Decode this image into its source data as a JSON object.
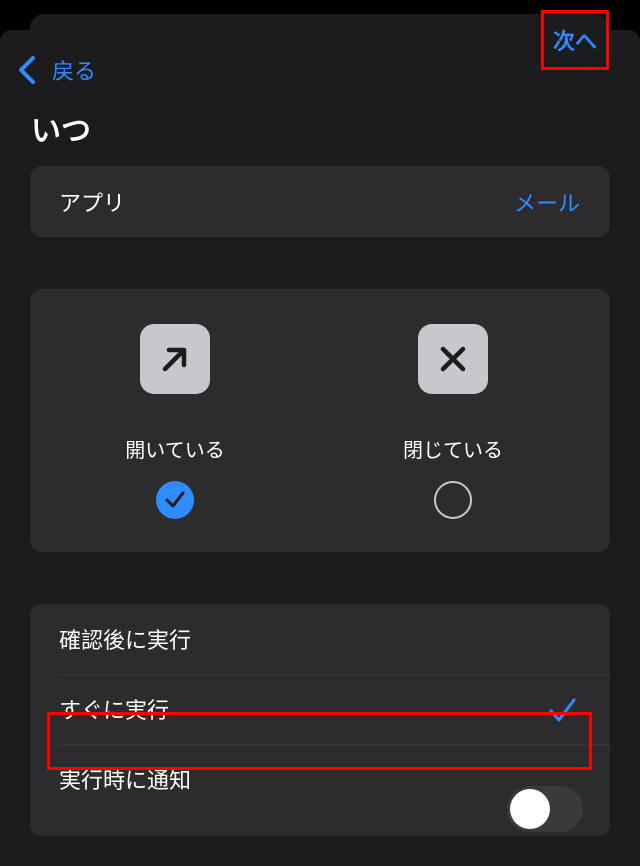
{
  "nav": {
    "back_label": "戻る",
    "next_label": "次へ"
  },
  "section": {
    "title": "いつ"
  },
  "app_row": {
    "label": "アプリ",
    "value": "メール"
  },
  "state_options": {
    "open": {
      "label": "開いている",
      "icon": "arrow-up-right-icon",
      "selected": true
    },
    "closed": {
      "label": "閉じている",
      "icon": "x-mark-icon",
      "selected": false
    }
  },
  "run_options": {
    "confirm_label": "確認後に実行",
    "immediate_label": "すぐに実行",
    "immediate_selected": true,
    "notify_label": "実行時に通知",
    "notify_on": false
  },
  "colors": {
    "accent": "#2f8cff",
    "highlight": "#ff0000",
    "card": "#2c2c2e",
    "sheet": "#1c1c1e"
  }
}
